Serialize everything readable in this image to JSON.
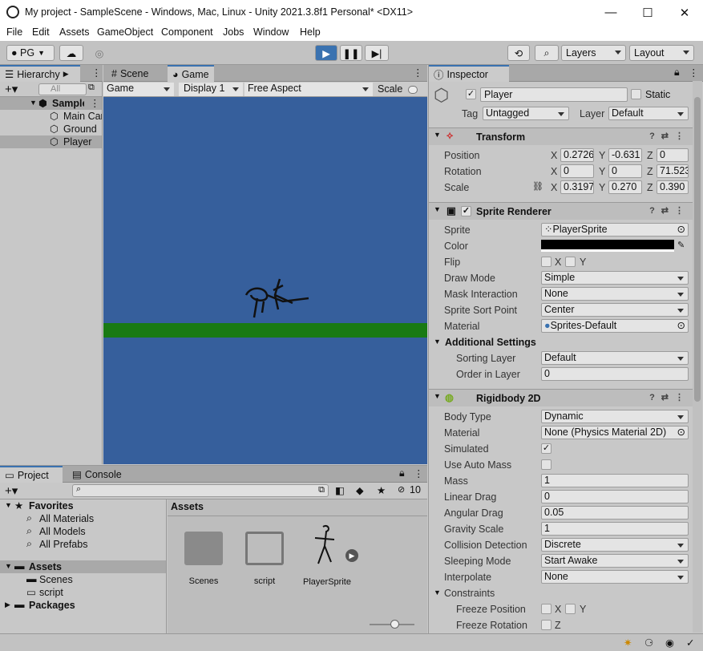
{
  "window": {
    "title": "My project - SampleScene - Windows, Mac, Linux - Unity 2021.3.8f1 Personal* <DX11>",
    "minimize": "—",
    "maximize": "☐",
    "close": "✕"
  },
  "menu": [
    "File",
    "Edit",
    "Assets",
    "GameObject",
    "Component",
    "Jobs",
    "Window",
    "Help"
  ],
  "toolbar": {
    "account": "PG",
    "layers": "Layers",
    "layout": "Layout"
  },
  "hierarchy": {
    "tab": "Hierarchy",
    "search_placeholder": "All",
    "scene": "SampleScene",
    "items": [
      "Main Camera",
      "Ground",
      "Player"
    ]
  },
  "game": {
    "scene_tab": "Scene",
    "game_tab": "Game",
    "mode": "Game",
    "display": "Display 1",
    "aspect": "Free Aspect",
    "scale": "Scale"
  },
  "inspector": {
    "tab": "Inspector",
    "object_name": "Player",
    "static_label": "Static",
    "tag_label": "Tag",
    "tag": "Untagged",
    "layer_label": "Layer",
    "layer": "Default",
    "transform": {
      "title": "Transform",
      "position_label": "Position",
      "rotation_label": "Rotation",
      "scale_label": "Scale",
      "position": {
        "x": "0.2726",
        "y": "-0.631",
        "z": "0"
      },
      "rotation": {
        "x": "0",
        "y": "0",
        "z": "71.523"
      },
      "scale": {
        "x": "0.3197",
        "y": "0.270",
        "z": "0.390"
      }
    },
    "sprite_renderer": {
      "title": "Sprite Renderer",
      "sprite_label": "Sprite",
      "sprite": "PlayerSprite",
      "color_label": "Color",
      "color": "#000000",
      "flip_label": "Flip",
      "flip_x": "X",
      "flip_y": "Y",
      "draw_mode_label": "Draw Mode",
      "draw_mode": "Simple",
      "mask_label": "Mask Interaction",
      "mask": "None",
      "sort_point_label": "Sprite Sort Point",
      "sort_point": "Center",
      "material_label": "Material",
      "material": "Sprites-Default",
      "additional": "Additional Settings",
      "sorting_layer_label": "Sorting Layer",
      "sorting_layer": "Default",
      "order_label": "Order in Layer",
      "order": "0"
    },
    "rigidbody": {
      "title": "Rigidbody 2D",
      "body_type_label": "Body Type",
      "body_type": "Dynamic",
      "material_label": "Material",
      "material": "None (Physics Material 2D)",
      "simulated_label": "Simulated",
      "auto_mass_label": "Use Auto Mass",
      "mass_label": "Mass",
      "mass": "1",
      "linear_drag_label": "Linear Drag",
      "linear_drag": "0",
      "angular_drag_label": "Angular Drag",
      "angular_drag": "0.05",
      "gravity_label": "Gravity Scale",
      "gravity": "1",
      "collision_label": "Collision Detection",
      "collision": "Discrete",
      "sleeping_label": "Sleeping Mode",
      "sleeping": "Start Awake",
      "interpolate_label": "Interpolate",
      "interpolate": "None",
      "constraints_label": "Constraints",
      "freeze_pos_label": "Freeze Position",
      "freeze_rot_label": "Freeze Rotation",
      "x": "X",
      "y": "Y",
      "z": "Z"
    }
  },
  "project": {
    "tab": "Project",
    "console_tab": "Console",
    "hidden_count": "10",
    "favorites": "Favorites",
    "fav_items": [
      "All Materials",
      "All Models",
      "All Prefabs"
    ],
    "assets_root": "Assets",
    "asset_folders": [
      "Scenes",
      "script"
    ],
    "packages": "Packages",
    "breadcrumb": "Assets",
    "items": [
      "Scenes",
      "script",
      "PlayerSprite"
    ]
  },
  "colors": {
    "game_bg": "#365f9c",
    "ground": "#197a13",
    "accent": "#3a72b0"
  }
}
